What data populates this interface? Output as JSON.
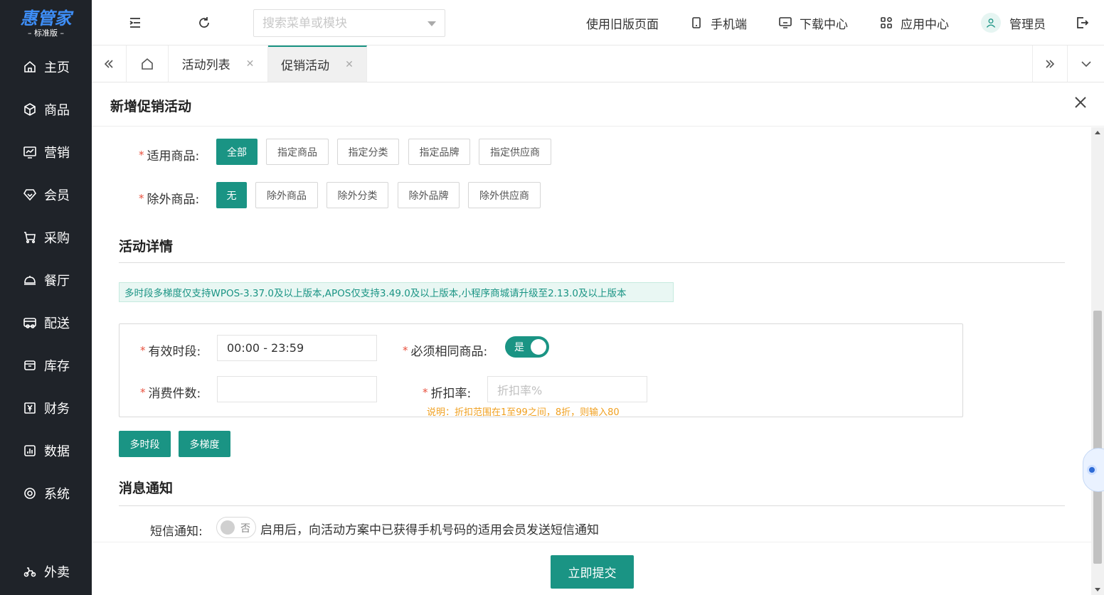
{
  "brand": {
    "name": "惠管家",
    "edition": "标准版"
  },
  "sidebar": {
    "items": [
      {
        "label": "主页",
        "icon": "home-icon"
      },
      {
        "label": "商品",
        "icon": "cube-icon"
      },
      {
        "label": "营销",
        "icon": "chart-icon"
      },
      {
        "label": "会员",
        "icon": "diamond-icon"
      },
      {
        "label": "采购",
        "icon": "cart-icon"
      },
      {
        "label": "餐厅",
        "icon": "bell-icon"
      },
      {
        "label": "配送",
        "icon": "delivery-icon"
      },
      {
        "label": "库存",
        "icon": "box-icon"
      },
      {
        "label": "财务",
        "icon": "yen-icon"
      },
      {
        "label": "数据",
        "icon": "bar-chart-icon"
      },
      {
        "label": "系统",
        "icon": "gear-icon"
      },
      {
        "label": "外卖",
        "icon": "scooter-icon"
      }
    ]
  },
  "topbar": {
    "search_placeholder": "搜索菜单或模块",
    "old_version": "使用旧版页面",
    "mobile": "手机端",
    "download": "下载中心",
    "apps": "应用中心",
    "user": "管理员"
  },
  "tabs": [
    {
      "label": "活动列表"
    },
    {
      "label": "促销活动",
      "active": true
    }
  ],
  "panel": {
    "title": "新增促销活动"
  },
  "form": {
    "applicable": {
      "label": "适用商品:",
      "options": [
        "全部",
        "指定商品",
        "指定分类",
        "指定品牌",
        "指定供应商"
      ],
      "selected": "全部"
    },
    "excluded": {
      "label": "除外商品:",
      "options": [
        "无",
        "除外商品",
        "除外分类",
        "除外品牌",
        "除外供应商"
      ],
      "selected": "无"
    }
  },
  "detail": {
    "title": "活动详情",
    "notice": "多时段多梯度仅支持WPOS-3.37.0及以上版本,APOS仅支持3.49.0及以上版本,小程序商城请升级至2.13.0及以上版本",
    "period_label": "有效时段:",
    "period_value": "00:00 - 23:59",
    "same_goods_label": "必须相同商品:",
    "same_goods_value": "是",
    "qty_label": "消费件数:",
    "qty_value": "",
    "discount_label": "折扣率:",
    "discount_placeholder": "折扣率%",
    "discount_hint": "说明：折扣范围在1至99之间，8折，则输入80",
    "btn_multi_period": "多时段",
    "btn_multi_tier": "多梯度"
  },
  "notify": {
    "title": "消息通知",
    "sms_label": "短信通知:",
    "sms_value": "否",
    "sms_desc": "启用后，向活动方案中已获得手机号码的适用会员发送短信通知"
  },
  "footer": {
    "submit": "立即提交"
  },
  "colors": {
    "accent": "#1a9484",
    "sidebar": "#1f2329",
    "brand": "#3e8ef7",
    "required": "#e8513e",
    "hint": "#f0a020"
  }
}
